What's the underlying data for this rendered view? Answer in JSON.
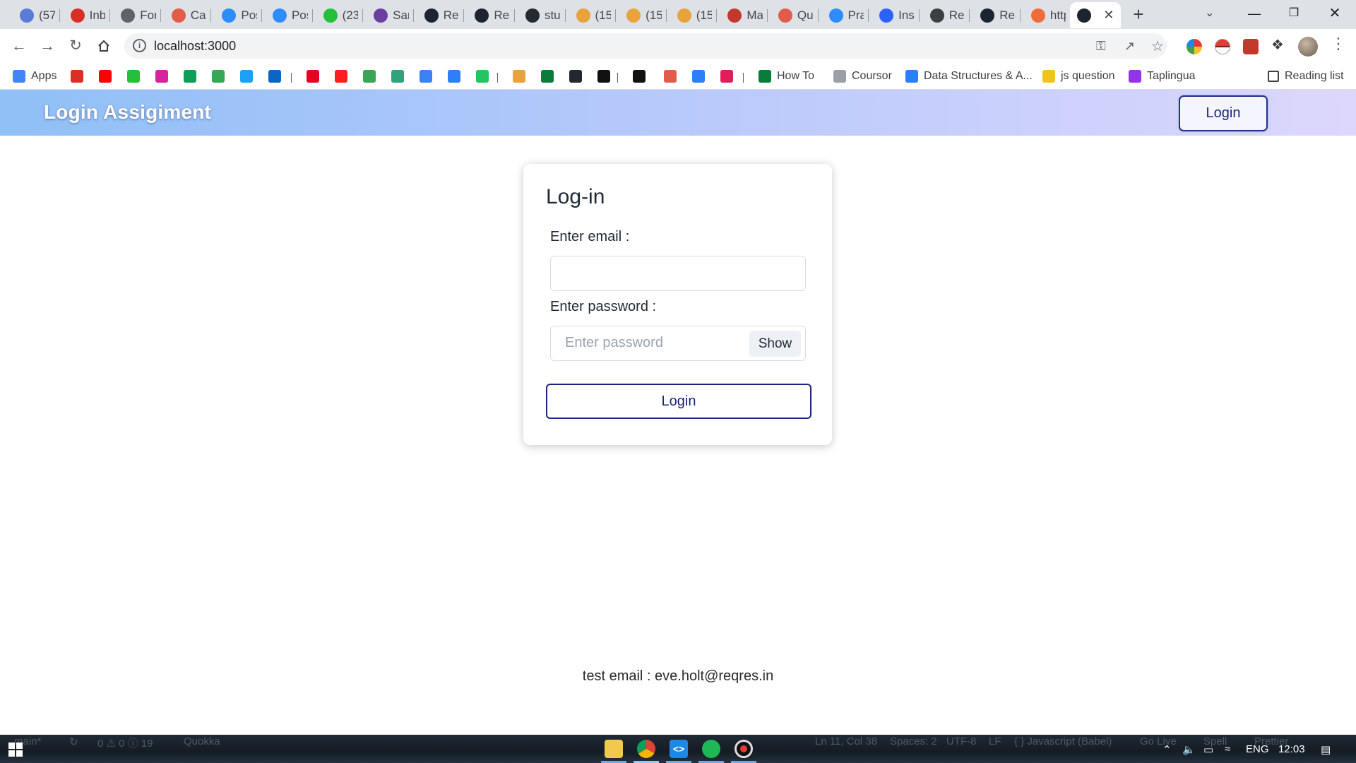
{
  "browser": {
    "tabs": [
      {
        "title": "(57",
        "color": "#5a7bd6"
      },
      {
        "title": "Inb",
        "color": "#d93025"
      },
      {
        "title": "For",
        "color": "#5f6368"
      },
      {
        "title": "Cal",
        "color": "#e25c4b"
      },
      {
        "title": "Pos",
        "color": "#2d8cff"
      },
      {
        "title": "Pos",
        "color": "#2d8cff"
      },
      {
        "title": "(23",
        "color": "#25c03a"
      },
      {
        "title": "Sar",
        "color": "#6b3fa0"
      },
      {
        "title": "Rea",
        "color": "#1b2430"
      },
      {
        "title": "Rea",
        "color": "#1b2430"
      },
      {
        "title": "stu",
        "color": "#24292f"
      },
      {
        "title": "(15",
        "color": "#e8a33d"
      },
      {
        "title": "(15",
        "color": "#e8a33d"
      },
      {
        "title": "(15",
        "color": "#e8a33d"
      },
      {
        "title": "Ma",
        "color": "#c0392b"
      },
      {
        "title": "Qu",
        "color": "#e25c4b"
      },
      {
        "title": "Pra",
        "color": "#2d8cff"
      },
      {
        "title": "Insi",
        "color": "#2962ff"
      },
      {
        "title": "Rec",
        "color": "#3c4043"
      },
      {
        "title": "Rea",
        "color": "#1b2430"
      },
      {
        "title": "http",
        "color": "#f26b3a"
      }
    ],
    "active_tab_color": "#1b2430",
    "address": "localhost:3000",
    "bookmarks": [
      {
        "label": "Apps",
        "color": "#4285f4"
      },
      {
        "label": "",
        "color": "#d93025"
      },
      {
        "label": "",
        "color": "#ff0000"
      },
      {
        "label": "",
        "color": "#25c03a"
      },
      {
        "label": "",
        "color": "#d6249f"
      },
      {
        "label": "",
        "color": "#0f9d58"
      },
      {
        "label": "",
        "color": "#34a853"
      },
      {
        "label": "",
        "color": "#1da1f2"
      },
      {
        "label": "",
        "color": "#0a66c2"
      },
      {
        "label": "",
        "color": "#e60023"
      },
      {
        "label": "",
        "color": "#ff1f1f"
      },
      {
        "label": "",
        "color": "#3aa655"
      },
      {
        "label": "",
        "color": "#2fa37a"
      },
      {
        "label": "",
        "color": "#3b82f6"
      },
      {
        "label": "",
        "color": "#2d7ff9"
      },
      {
        "label": "",
        "color": "#22c55e"
      },
      {
        "label": "",
        "color": "#e8a33d"
      },
      {
        "label": "",
        "color": "#0a7c3a"
      },
      {
        "label": "",
        "color": "#24292f"
      },
      {
        "label": "",
        "color": "#111111"
      },
      {
        "label": "",
        "color": "#111111"
      },
      {
        "label": "",
        "color": "#e25c4b"
      },
      {
        "label": "",
        "color": "#2d7ff9"
      },
      {
        "label": "",
        "color": "#e01e5a"
      },
      {
        "label": "How To",
        "color": "#0a7c3a"
      },
      {
        "label": "Coursor",
        "color": "#9aa0a6"
      },
      {
        "label": "Data Structures & A...",
        "color": "#2d7ff9"
      },
      {
        "label": "js question",
        "color": "#f0c419"
      },
      {
        "label": "Taplingua",
        "color": "#9333ea"
      }
    ],
    "reading_list": "Reading list"
  },
  "app": {
    "brand": "Login Assigiment",
    "header_login": "Login",
    "card": {
      "title": "Log-in",
      "email_label": "Enter email :",
      "email_value": "",
      "password_label": "Enter password :",
      "password_placeholder": "Enter password",
      "show_label": "Show",
      "login_label": "Login"
    },
    "test_email": "test email : eve.holt@reqres.in"
  },
  "taskbar": {
    "status": {
      "branch": "main*",
      "problems": "0 ⚠ 0 ⓘ 19",
      "quokka": "Quokka",
      "position": "Ln 11, Col 38",
      "spaces": "Spaces: 2",
      "encoding": "UTF-8",
      "eol": "LF",
      "language": "{ } Javascript (Babel)",
      "golive": "Go Live",
      "spell": "Spell",
      "prettier": "Prettier"
    },
    "lang": "ENG",
    "time": "12:03"
  }
}
